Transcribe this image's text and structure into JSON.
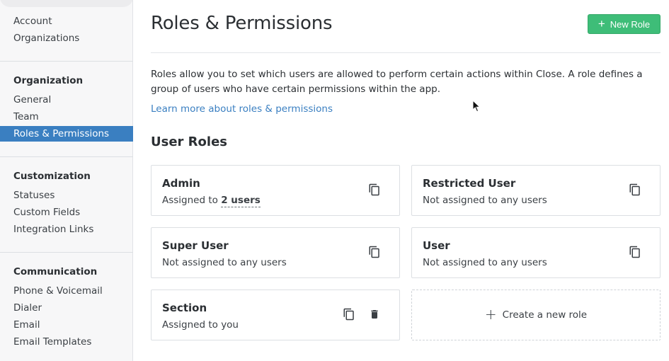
{
  "sidebar": {
    "top_links": [
      "Account",
      "Organizations"
    ],
    "groups": [
      {
        "heading": "Organization",
        "items": [
          "General",
          "Team",
          "Roles & Permissions"
        ],
        "active": "Roles & Permissions"
      },
      {
        "heading": "Customization",
        "items": [
          "Statuses",
          "Custom Fields",
          "Integration Links"
        ]
      },
      {
        "heading": "Communication",
        "items": [
          "Phone & Voicemail",
          "Dialer",
          "Email",
          "Email Templates"
        ]
      }
    ]
  },
  "header": {
    "title": "Roles & Permissions",
    "new_role_button": {
      "icon": "+",
      "label": "New Role"
    }
  },
  "intro": {
    "text": "Roles allow you to set which users are allowed to perform certain actions within Close. A role defines a group of users who have certain permissions within the app.",
    "link": "Learn more about roles & permissions"
  },
  "roles_section": {
    "title": "User Roles",
    "roles": [
      {
        "name": "Admin",
        "assignment_prefix": "Assigned to ",
        "assignment_count": "2 users",
        "icons": [
          "copy-icon"
        ]
      },
      {
        "name": "Restricted User",
        "assignment": "Not assigned to any users",
        "icons": [
          "copy-icon"
        ]
      },
      {
        "name": "Super User",
        "assignment": "Not assigned to any users",
        "icons": [
          "copy-icon"
        ]
      },
      {
        "name": "User",
        "assignment": "Not assigned to any users",
        "icons": [
          "copy-icon"
        ]
      },
      {
        "name": "Section",
        "assignment": "Assigned to you",
        "icons": [
          "copy-icon",
          "trash-icon"
        ]
      }
    ],
    "create_new": {
      "icon": "+",
      "label": "Create a new role"
    }
  },
  "colors": {
    "accent_blue": "#3a7fc1",
    "button_green": "#3ebd78",
    "sidebar_bg": "#f7f7f8",
    "text": "#2b2f33"
  }
}
